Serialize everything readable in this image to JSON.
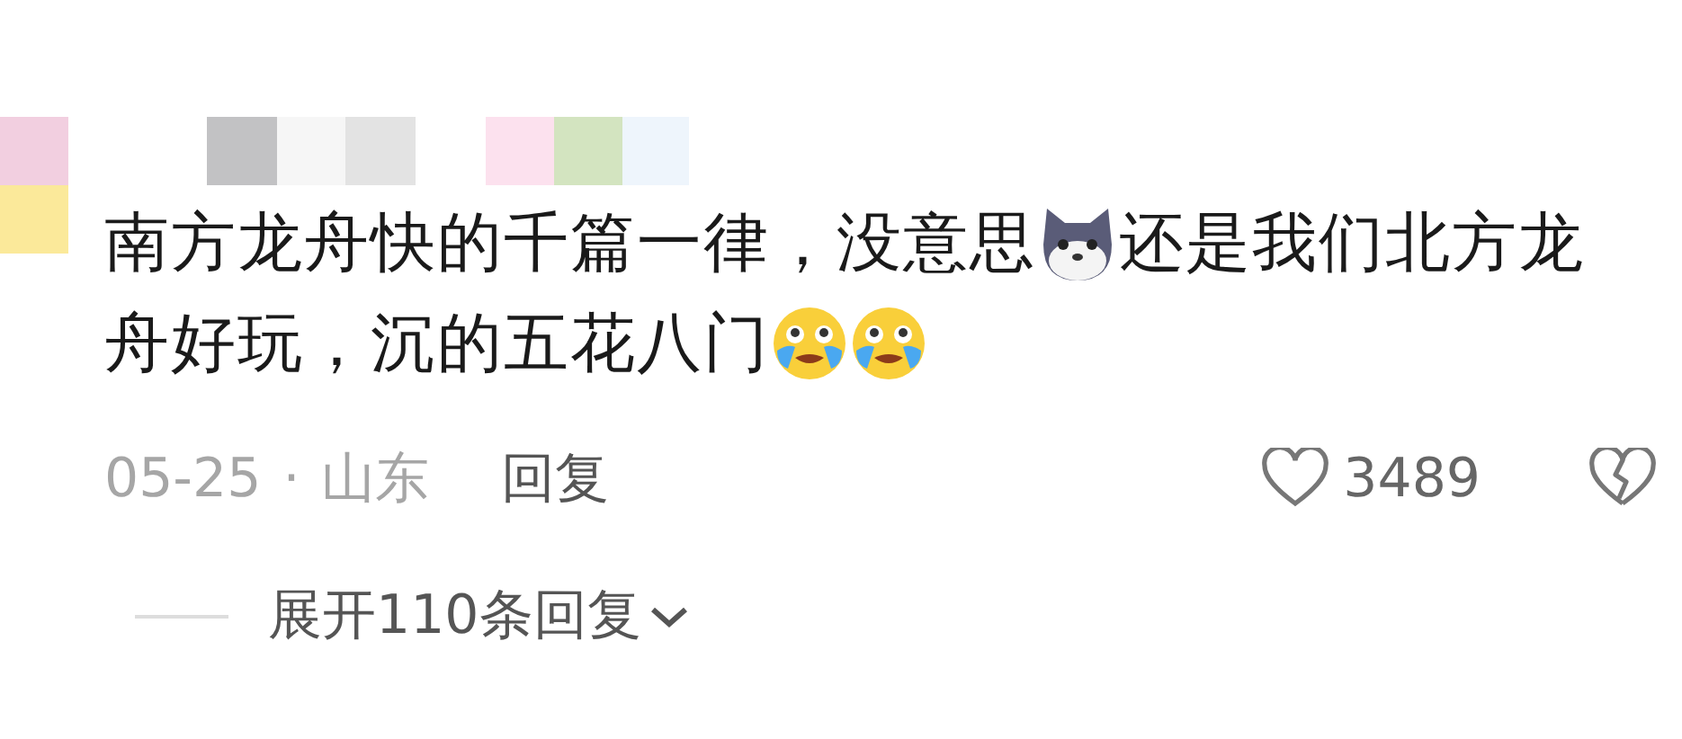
{
  "comment": {
    "lines": [
      [
        {
          "kind": "text",
          "text": "南方龙舟快的千篇一律，没意思"
        },
        {
          "kind": "dog"
        },
        {
          "kind": "text",
          "text": "还是我们北方龙"
        }
      ],
      [
        {
          "kind": "text",
          "text": "舟好玩，沉的五花八门"
        },
        {
          "kind": "cry"
        },
        {
          "kind": "cry"
        }
      ]
    ],
    "date": "05-25",
    "separator": "·",
    "location": "山东",
    "reply": "回复",
    "likes": "3489",
    "liked": false,
    "expand": "展开110条回复"
  }
}
